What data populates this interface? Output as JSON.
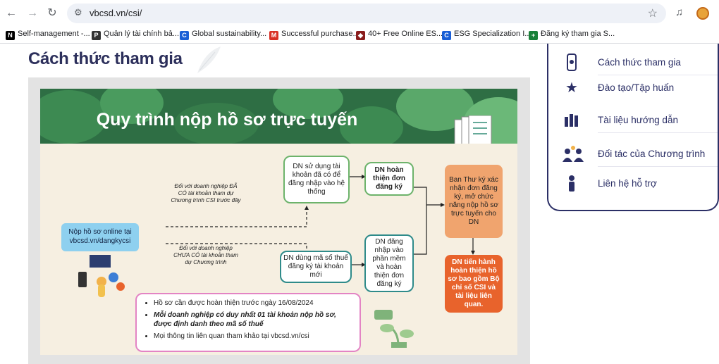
{
  "browser": {
    "url": "vbcsd.vn/csi/",
    "bookmarks": [
      {
        "label": "Self-management -...",
        "icon": "notion-icon",
        "color": "#000000",
        "glyph": "N"
      },
      {
        "label": "Quản lý tài chính bả...",
        "icon": "proton-icon",
        "color": "#333333",
        "glyph": "P"
      },
      {
        "label": "Global sustainability...",
        "icon": "coursera-icon",
        "color": "#1a5fd6",
        "glyph": "C"
      },
      {
        "label": "Successful purchase...",
        "icon": "gmail-icon",
        "color": "#d93025",
        "glyph": "M"
      },
      {
        "label": "40+ Free Online ES...",
        "icon": "diamond-icon",
        "color": "#8a1c1c",
        "glyph": "◆"
      },
      {
        "label": "ESG Specialization I...",
        "icon": "coursera-icon",
        "color": "#1a5fd6",
        "glyph": "C"
      },
      {
        "label": "Đăng ký tham gia S...",
        "icon": "sheets-icon",
        "color": "#188038",
        "glyph": "+"
      }
    ]
  },
  "page": {
    "title": "Cách thức tham gia"
  },
  "infographic": {
    "title": "Quy trình nộp hồ sơ trực tuyến",
    "online_box": "Nộp hồ sơ online tại vbcsd.vn/dangkycsi",
    "note_has_account": "Đối với doanh nghiệp ĐÃ CÓ tài khoản tham dự Chương trình CSI trước đây",
    "note_no_account": "Đối với doanh nghiệp CHƯA CÓ tài khoản tham dự Chương trình",
    "box_login": "DN sử dụng tài khoản đã có để đăng nhập vào hệ thống",
    "box_complete1": "DN hoàn thiện đơn đăng ký",
    "box_new_account": "DN dùng mã số thuế đăng ký tài khoản mới",
    "box_complete2": "DN đăng nhập vào phần mềm và hoàn thiện đơn đăng ký",
    "box_secretariat": "Ban Thư ký xác nhận đơn đăng ký, mở chức năng nộp hồ sơ trực tuyến cho DN",
    "box_final": "DN tiến hành hoàn thiện hồ sơ bao gồm Bộ chỉ số CSI và tài liệu liên quan.",
    "requirements": [
      "Hồ sơ cần được hoàn thiện trước ngày 16/08/2024",
      "Mỗi doanh nghiệp có duy nhất 01 tài khoản nộp hồ sơ, được định danh theo mã số thuế",
      "Mọi thông tin liên quan tham khảo tại vbcsd.vn/csi"
    ]
  },
  "menu": {
    "items": [
      {
        "label": "Cách thức tham gia",
        "icon": "phone-icon"
      },
      {
        "label": "Đào tạo/Tập huấn",
        "icon": "star-icon"
      },
      {
        "label": "Tài liệu hướng dẫn",
        "icon": "documents-icon"
      },
      {
        "label": "Đối tác của Chương trình",
        "icon": "partners-icon"
      },
      {
        "label": "Liên hệ hỗ trợ",
        "icon": "support-icon"
      }
    ]
  }
}
